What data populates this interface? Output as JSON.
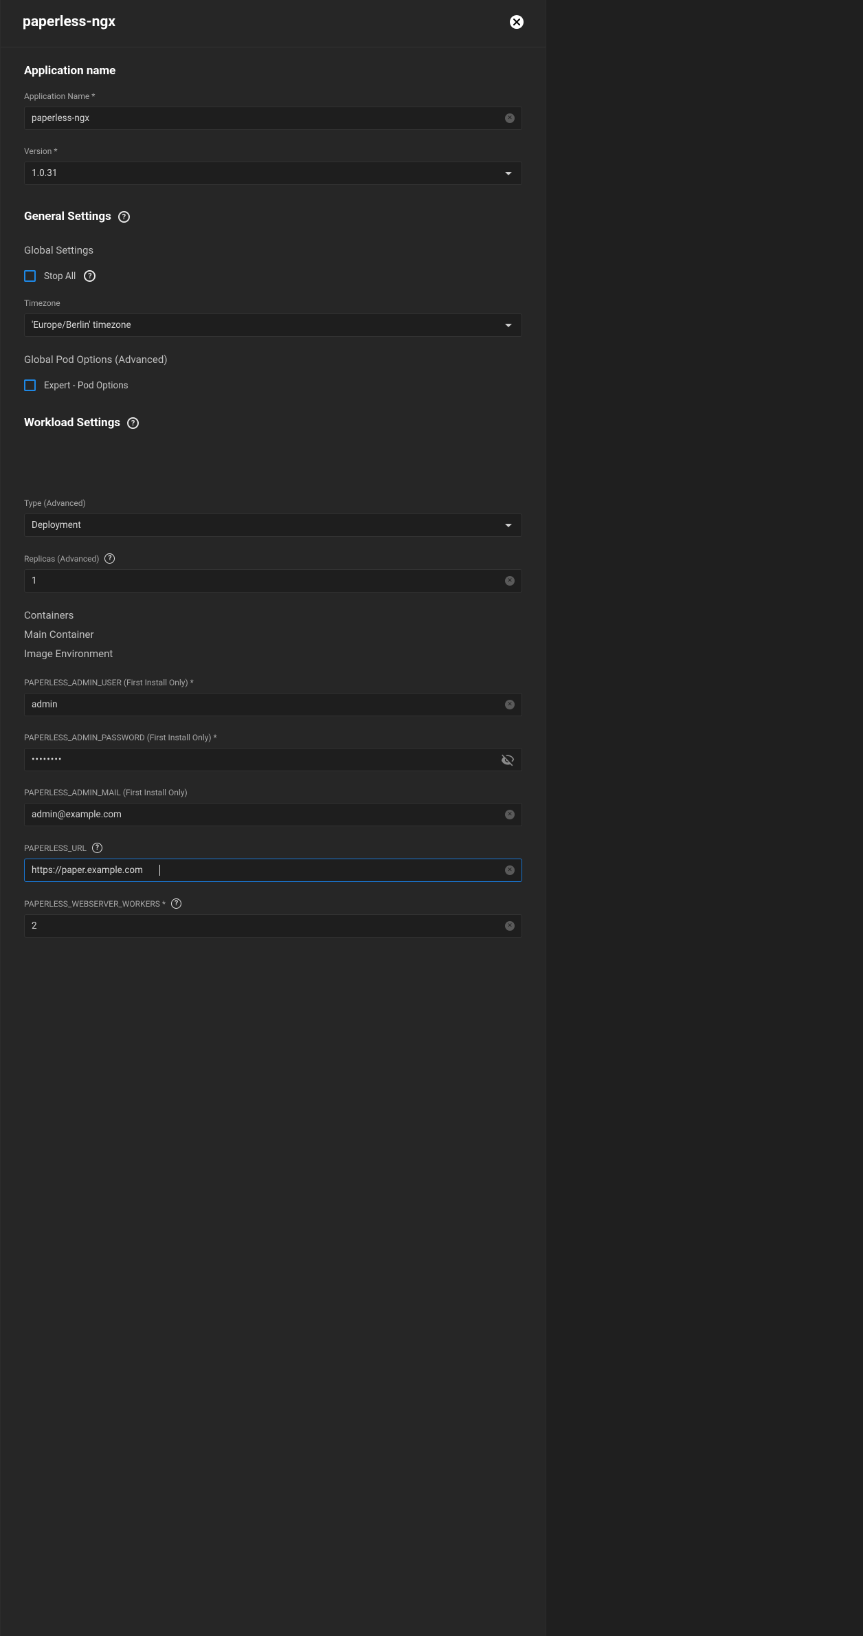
{
  "header": {
    "title": "paperless-ngx"
  },
  "sections": {
    "appName": {
      "title": "Application name",
      "nameLabel": "Application Name *",
      "nameValue": "paperless-ngx",
      "versionLabel": "Version *",
      "versionValue": "1.0.31"
    },
    "general": {
      "title": "General Settings",
      "globalSettings": "Global Settings",
      "stopAll": "Stop All",
      "timezoneLabel": "Timezone",
      "timezoneValue": "'Europe/Berlin' timezone",
      "globalPod": "Global Pod Options (Advanced)",
      "expertPod": "Expert - Pod Options"
    },
    "workload": {
      "title": "Workload Settings",
      "typeLabel": "Type (Advanced)",
      "typeValue": "Deployment",
      "replicasLabel": "Replicas (Advanced)",
      "replicasValue": "1",
      "containers": "Containers",
      "mainContainer": "Main Container",
      "imageEnv": "Image Environment",
      "adminUserLabel": "PAPERLESS_ADMIN_USER (First Install Only) *",
      "adminUserValue": "admin",
      "adminPasswordLabel": "PAPERLESS_ADMIN_PASSWORD (First Install Only) *",
      "adminPasswordValue": "••••••••",
      "adminMailLabel": "PAPERLESS_ADMIN_MAIL (First Install Only)",
      "adminMailValue": "admin@example.com",
      "urlLabel": "PAPERLESS_URL",
      "urlValue": "https://paper.example.com",
      "workersLabel": "PAPERLESS_WEBSERVER_WORKERS *",
      "workersValue": "2"
    }
  }
}
